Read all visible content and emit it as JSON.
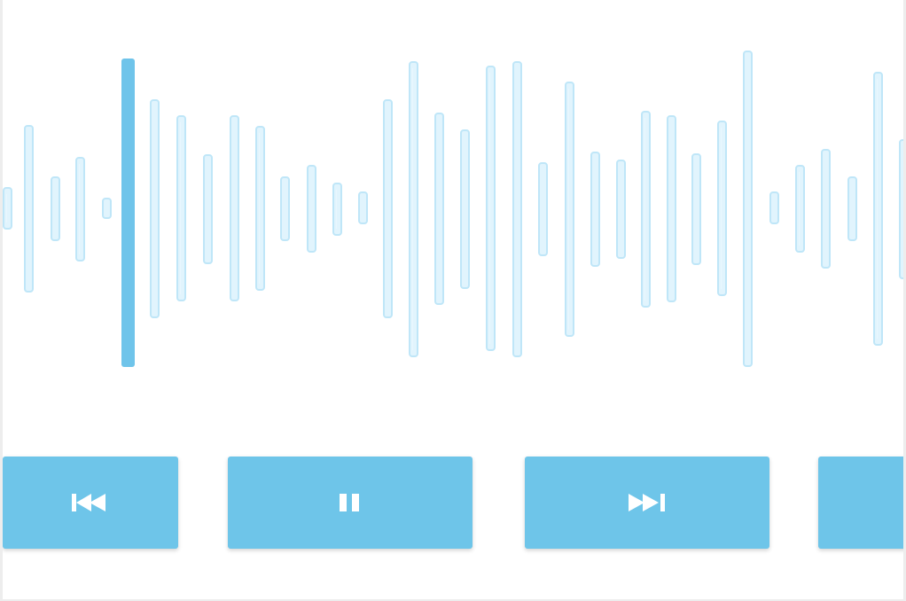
{
  "accent_color": "#6ec5e9",
  "waveform": {
    "bar_color": "#bfe6f8",
    "playhead_color": "#6fc4ea"
  },
  "controls": {
    "previous": {
      "icon": "skip-previous-icon"
    },
    "pause": {
      "icon": "pause-icon"
    },
    "next": {
      "icon": "skip-next-icon"
    },
    "extra": {
      "icon": ""
    }
  }
}
